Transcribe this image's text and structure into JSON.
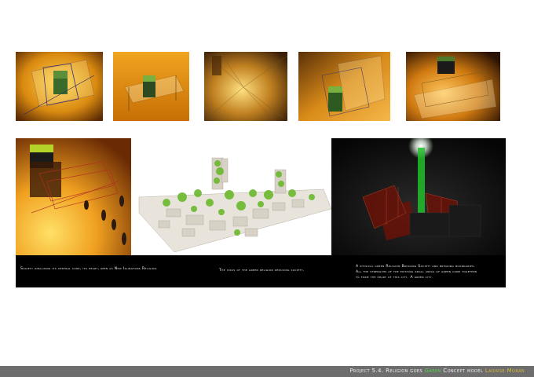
{
  "thumbnails": [
    {
      "alt": "model photo 1"
    },
    {
      "alt": "model photo 2"
    },
    {
      "alt": "model photo 3"
    },
    {
      "alt": "model photo 4"
    },
    {
      "alt": "model photo 5"
    }
  ],
  "panels": {
    "left_caption": "Society idealising its central core, its heart, seen as New Islingtons Religion.",
    "middle_caption": "The virus of the green religion reducing society.",
    "right_caption_line1": "A physical green Religion Bridging Society and breaking boundaries.",
    "right_caption_line2": "All the strengths of the existing small areas of green come together",
    "right_caption_line3": "to form the heart of this city. A green city."
  },
  "footer": {
    "part1": "Project 5.4.",
    "part2": "Religion goes",
    "green_word": "Green",
    "part3": "Concept model",
    "author": "Laoirse Moran"
  },
  "colors": {
    "amber": "#e89a18",
    "green": "#53d64b",
    "author": "#d9b93a",
    "footer_bg": "#6d6d6d"
  }
}
